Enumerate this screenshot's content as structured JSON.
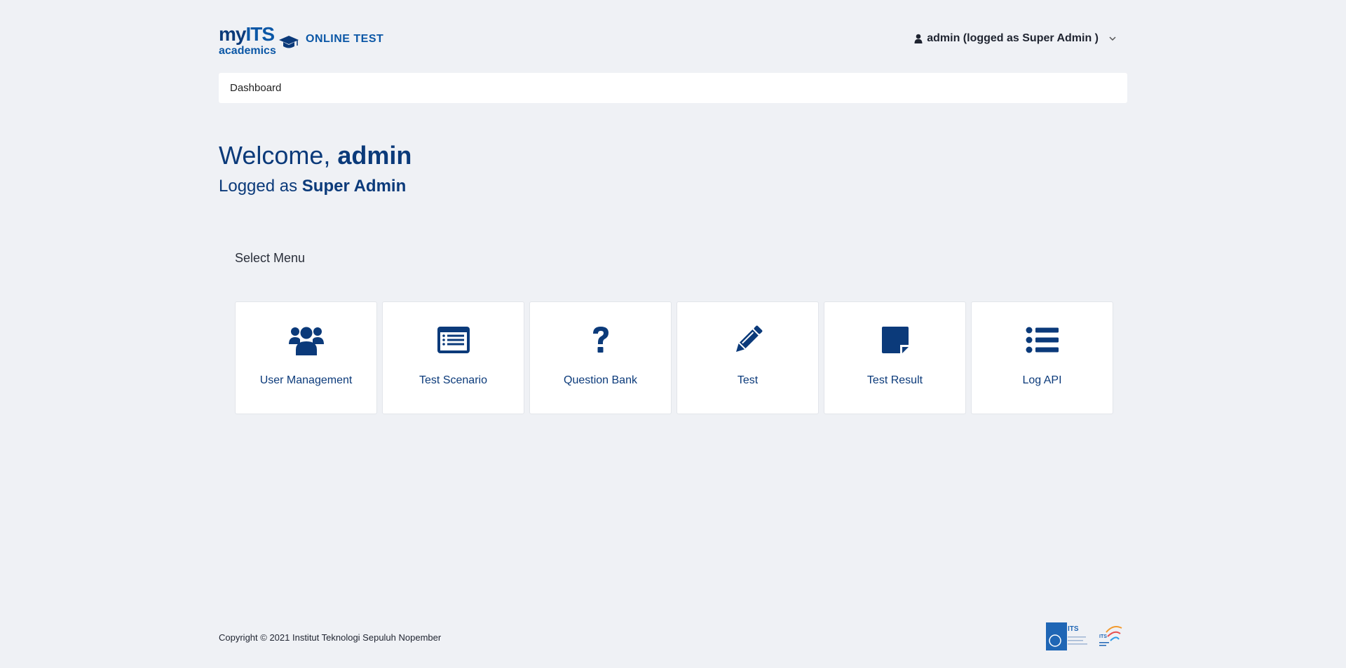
{
  "header": {
    "logo_my": "my",
    "logo_its": "ITS",
    "logo_academics": "academics",
    "app_name": "ONLINE TEST",
    "user_menu_label": "admin (logged as Super Admin )",
    "user_icon": "user-icon",
    "chevron_icon": "chevron-down-icon"
  },
  "breadcrumb": {
    "current": "Dashboard"
  },
  "welcome": {
    "prefix": "Welcome, ",
    "username": "admin",
    "role_prefix": "Logged as ",
    "role": "Super Admin"
  },
  "menu": {
    "title": "Select Menu",
    "items": [
      {
        "label": "User Management",
        "icon": "users-icon"
      },
      {
        "label": "Test Scenario",
        "icon": "list-alt-icon"
      },
      {
        "label": "Question Bank",
        "icon": "question-icon"
      },
      {
        "label": "Test",
        "icon": "pencil-icon"
      },
      {
        "label": "Test Result",
        "icon": "sticky-note-icon"
      },
      {
        "label": "Log API",
        "icon": "list-icon"
      }
    ]
  },
  "footer": {
    "copyright": "Copyright © 2021 Institut Teknologi Sepuluh Nopember",
    "logo_its": "ITS",
    "logo_tagline": "ITS SEMANGAT BARU"
  },
  "colors": {
    "accent": "#0b3a7a",
    "brand_blue": "#0b57a6",
    "background": "#eff1f5"
  }
}
